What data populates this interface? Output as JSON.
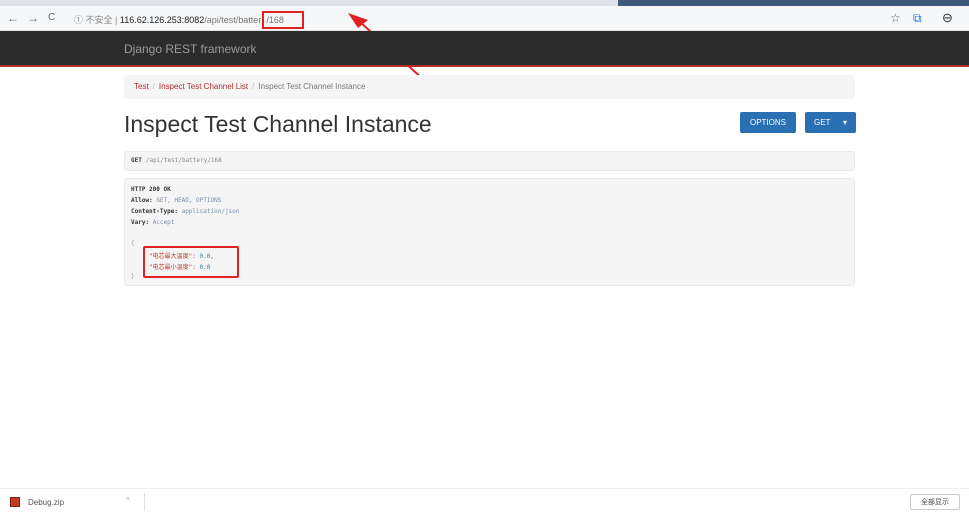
{
  "browser": {
    "nav": {
      "back": "←",
      "forward": "→",
      "reload": "C"
    },
    "url": {
      "insecure_label": "① 不安全 |",
      "host": "116.62.126.253:8082",
      "path": "/api/test/batter",
      "highlighted_id": "/168"
    },
    "icons": {
      "bookmark": "☆",
      "translate": "⧉",
      "profile": "⊖"
    }
  },
  "navbar": {
    "brand": "Django REST framework"
  },
  "breadcrumb": {
    "items": [
      {
        "label": "Test"
      },
      {
        "label": "Inspect Test Channel List"
      },
      {
        "label": "Inspect Test Channel Instance"
      }
    ]
  },
  "page": {
    "title": "Inspect Test Channel Instance"
  },
  "buttons": {
    "options": "OPTIONS",
    "get": "GET",
    "get_caret": "▾"
  },
  "request": {
    "method": "GET",
    "path": "/api/test/battery/168"
  },
  "response": {
    "status": "HTTP 200 OK",
    "headers": [
      {
        "key": "Allow:",
        "value": "GET, HEAD, OPTIONS"
      },
      {
        "key": "Content-Type:",
        "value": "application/json"
      },
      {
        "key": "Vary:",
        "value": "Accept"
      }
    ],
    "open_brace": "{",
    "close_brace": "}",
    "body": [
      {
        "key": "\"电芯最大温度\":",
        "value": "0.0,"
      },
      {
        "key": "\"电芯最小温度\":",
        "value": "0.0"
      }
    ]
  },
  "downloads": {
    "file": "Debug.zip",
    "caret": "^",
    "show_all": "全部显示"
  },
  "colors": {
    "navbar": "#2c2c2c",
    "accent": "#b22c2c",
    "button": "#2a6fb2",
    "annotation": "#e02222"
  }
}
